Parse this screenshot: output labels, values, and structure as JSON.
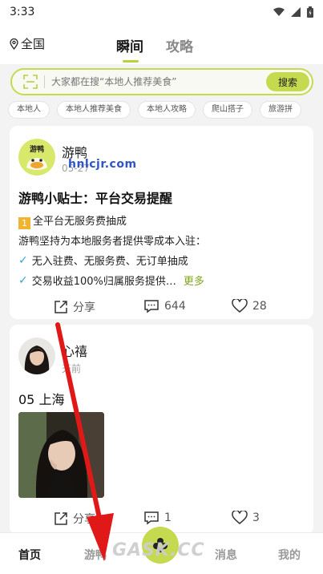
{
  "status_bar": {
    "time": "3:33",
    "icons": [
      "wifi-icon",
      "signal-icon",
      "battery-icon"
    ]
  },
  "top_nav": {
    "location": "全国",
    "tabs": [
      {
        "label": "瞬间",
        "active": true
      },
      {
        "label": "攻略",
        "active": false
      }
    ]
  },
  "search": {
    "placeholder": "大家都在搜“本地人推荐美食”",
    "button_label": "搜索"
  },
  "chips": [
    "本地人",
    "本地人推荐美食",
    "本地人攻略",
    "爬山搭子",
    "旅游拼"
  ],
  "posts": [
    {
      "author": "游鸭",
      "avatar_text": "游鸭",
      "date": "05-27",
      "title": "游鸭小贴士：平台交易提醒",
      "badge_number": "1",
      "line1": "全平台无服务费抽成",
      "line2": "游鸭坚持为本地服务者提供零成本入驻：",
      "check1": "无入驻费、无服务费、无订单抽成",
      "check2": "交易收益100%归属服务提供…",
      "more_label": "更多",
      "share_label": "分享",
      "comments": "644",
      "likes": "28"
    },
    {
      "author": "心禧",
      "date": "天前",
      "body": "05 上海",
      "share_label": "分享",
      "comments": "1",
      "likes": "3"
    }
  ],
  "watermark": "hnlcjr.com",
  "bottom_nav": {
    "home": "首页",
    "travel": "游鸭",
    "messages": "消息",
    "mine": "我的"
  },
  "corner_logo": "GASK.CC",
  "colors": {
    "accent": "#c6da50",
    "more": "#7fa51e",
    "check": "#3aa0dc",
    "arrow": "#e01818"
  }
}
